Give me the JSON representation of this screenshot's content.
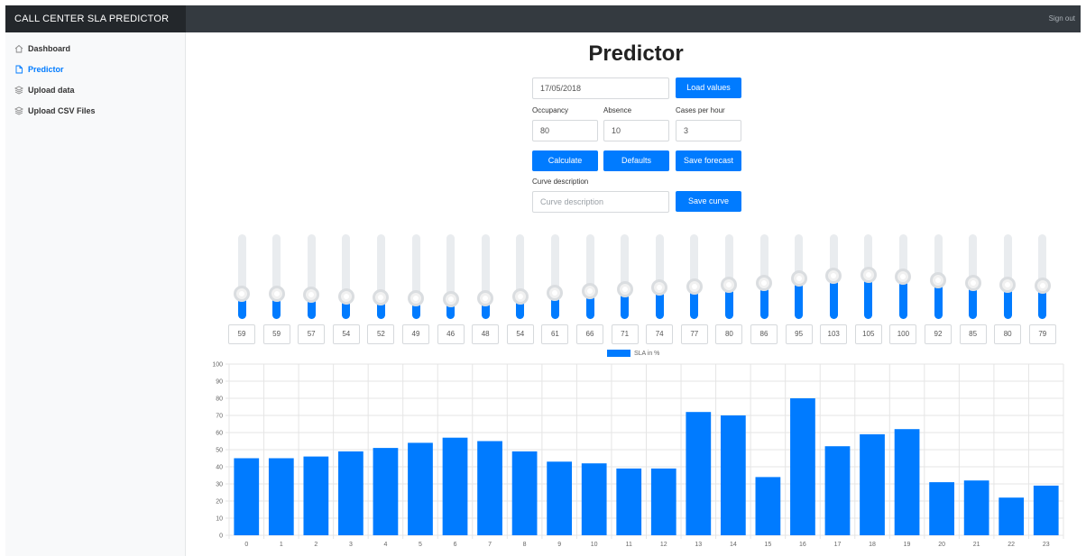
{
  "header": {
    "brand": "CALL CENTER SLA PREDICTOR",
    "signout": "Sign out"
  },
  "sidebar": {
    "items": [
      {
        "label": "Dashboard",
        "icon": "home-icon",
        "active": false
      },
      {
        "label": "Predictor",
        "icon": "file-icon",
        "active": true
      },
      {
        "label": "Upload data",
        "icon": "layers-icon",
        "active": false
      },
      {
        "label": "Upload CSV Files",
        "icon": "layers-icon",
        "active": false
      }
    ]
  },
  "main": {
    "title": "Predictor",
    "date_value": "17/05/2018",
    "load_values_label": "Load values",
    "occupancy_label": "Occupancy",
    "occupancy_value": "80",
    "absence_label": "Absence",
    "absence_value": "10",
    "cases_label": "Cases per hour",
    "cases_value": "3",
    "calculate_label": "Calculate",
    "defaults_label": "Defaults",
    "save_forecast_label": "Save forecast",
    "curve_description_label": "Curve description",
    "curve_description_placeholder": "Curve description",
    "save_curve_label": "Save curve"
  },
  "sliders": {
    "max": 200,
    "values": [
      59,
      59,
      57,
      54,
      52,
      49,
      46,
      48,
      54,
      61,
      66,
      71,
      74,
      77,
      80,
      86,
      95,
      103,
      105,
      100,
      92,
      85,
      80,
      79
    ]
  },
  "colors": {
    "accent": "#007bff",
    "topbar": "#343a40"
  },
  "chart_data": {
    "type": "bar",
    "legend": "SLA in %",
    "categories": [
      "0",
      "1",
      "2",
      "3",
      "4",
      "5",
      "6",
      "7",
      "8",
      "9",
      "10",
      "11",
      "12",
      "13",
      "14",
      "15",
      "16",
      "17",
      "18",
      "19",
      "20",
      "21",
      "22",
      "23"
    ],
    "series": [
      {
        "name": "SLA in %",
        "values": [
          45,
          45,
          46,
          49,
          51,
          54,
          57,
          55,
          49,
          43,
          42,
          39,
          39,
          72,
          70,
          34,
          80,
          52,
          59,
          62,
          31,
          32,
          22,
          29
        ]
      }
    ],
    "ylim": [
      0,
      100
    ],
    "yticks": [
      0,
      10,
      20,
      30,
      40,
      50,
      60,
      70,
      80,
      90,
      100
    ],
    "grid": true,
    "legend_position": "top"
  }
}
